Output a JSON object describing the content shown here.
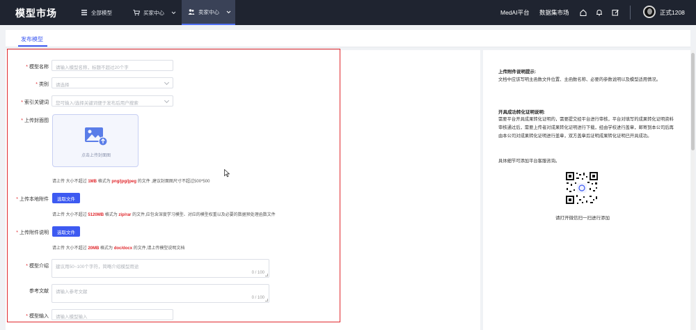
{
  "header": {
    "brand": "模型市场",
    "nav": [
      {
        "label": "全部模型",
        "icon": "grid-icon"
      },
      {
        "label": "买家中心",
        "icon": "cart-icon"
      },
      {
        "label": "卖家中心",
        "icon": "users-icon"
      }
    ],
    "links": [
      "MedAI平台",
      "数据集市场"
    ],
    "username": "正式1208"
  },
  "tabs": {
    "active": "发布模型"
  },
  "form": {
    "model_name": {
      "label": "模型名称",
      "placeholder": "请输入模型名称，标题不超过20个字"
    },
    "category": {
      "label": "类别",
      "placeholder": "请选择"
    },
    "keywords": {
      "label": "索引关键词",
      "placeholder": "您可输入/选择关键词便于发布后用户搜索"
    },
    "cover": {
      "label": "上传封面图",
      "upload_text": "点击上传封面图",
      "hint_prefix": "请上传 大小不超过",
      "hint_size": "1MB",
      "hint_mid": "格式为",
      "hint_format": "png/jpg/jpeg",
      "hint_suffix": "的文件 ,建议封面图尺寸不超过500*500"
    },
    "local_file": {
      "label": "上传本地附件",
      "button": "选取文件",
      "hint_prefix": "请上传 大小不超过",
      "hint_size": "5120MB",
      "hint_mid": "格式为",
      "hint_format": "zip/rar",
      "hint_suffix": "的文件,应包含深度学习模型、对应的模型权重以及必要的数据预处理函数文件"
    },
    "attachment_doc": {
      "label": "上传附件说明",
      "button": "选取文件",
      "hint_prefix": "请上传 大小不超过",
      "hint_size": "20MB",
      "hint_mid": "格式为",
      "hint_format": "doc/docx",
      "hint_suffix": "的文件,请上传模型说明文档"
    },
    "intro": {
      "label": "模型介绍",
      "placeholder": "建议用50~100个字符，简略介绍模型用途",
      "counter": "0 / 100"
    },
    "references": {
      "label": "参考文献",
      "placeholder": "请输入参考文献",
      "counter": "0 / 100"
    },
    "model_input": {
      "label": "模型输入",
      "placeholder": "请输入模型输入"
    }
  },
  "help": {
    "section1_title": "上传附件说明提示:",
    "section1_body": "文档中应该写明主函数文件位置、主函数名称、必要的参数说明以及模型适用情况。",
    "section2_title": "开具成功转化证明说明:",
    "section2_body": "需要平台开具成果转化证明的，需要提交经平台进行审核，平台对填写的成果转化证明资料审核通过后，需要上传者对成果转化证明进行下载，经由学校进行盖章，邮寄到本公司后再由本公司对成果转化证明进行盖章，双方盖章后证明成果转化证明已开具成功。",
    "section2_footer": "具体细节可添加平台客服咨询。",
    "qr_caption": "请打开微信扫一扫进行添加"
  },
  "colors": {
    "primary": "#3d5af1",
    "danger": "#e0262b",
    "nav_bg": "#1f2430"
  }
}
